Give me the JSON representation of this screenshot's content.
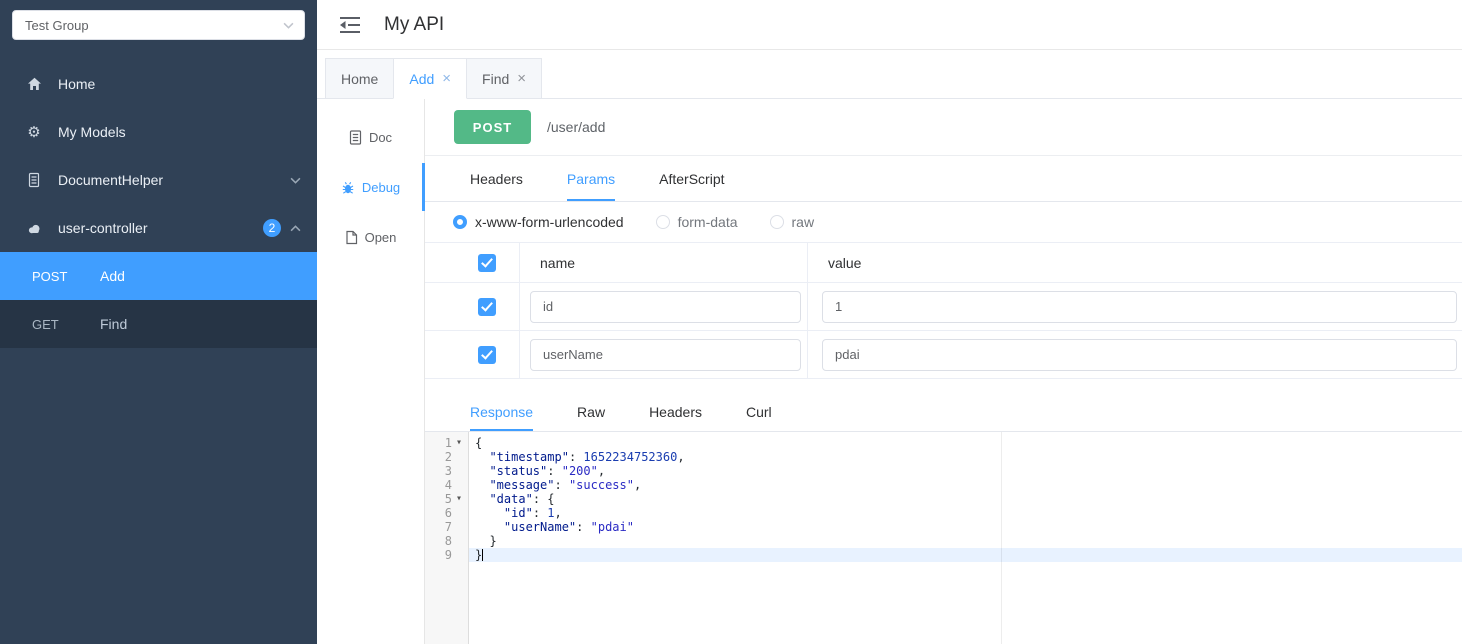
{
  "sidebar": {
    "group_select": {
      "value": "Test Group"
    },
    "menu": [
      {
        "label": "Home",
        "icon": "home-icon"
      },
      {
        "label": "My Models",
        "icon": "models-icon"
      },
      {
        "label": "DocumentHelper",
        "icon": "document-icon",
        "expand": "down"
      },
      {
        "label": "user-controller",
        "icon": "controller-icon",
        "badge": "2",
        "expand": "up"
      }
    ],
    "submenu": [
      {
        "method": "POST",
        "label": "Add",
        "active": true
      },
      {
        "method": "GET",
        "label": "Find",
        "active": false
      }
    ]
  },
  "header": {
    "title": "My API"
  },
  "page_tabs": [
    {
      "label": "Home",
      "closable": false,
      "active": false
    },
    {
      "label": "Add",
      "closable": true,
      "active": true
    },
    {
      "label": "Find",
      "closable": true,
      "active": false
    }
  ],
  "tools": [
    {
      "label": "Doc",
      "active": false
    },
    {
      "label": "Debug",
      "active": true
    },
    {
      "label": "Open",
      "active": false
    }
  ],
  "request": {
    "method": "POST",
    "method_color": "#53b987",
    "path": "/user/add",
    "tabs": [
      "Headers",
      "Params",
      "AfterScript"
    ],
    "active_tab": "Params",
    "body_types": [
      "x-www-form-urlencoded",
      "form-data",
      "raw"
    ],
    "selected_body_type": "x-www-form-urlencoded",
    "params": {
      "columns": [
        "name",
        "value"
      ],
      "rows": [
        {
          "checked": true,
          "name": "id",
          "value": "1"
        },
        {
          "checked": true,
          "name": "userName",
          "value": "pdai"
        }
      ]
    }
  },
  "response": {
    "tabs": [
      "Response",
      "Raw",
      "Headers",
      "Curl"
    ],
    "active_tab": "Response",
    "editor": {
      "active_line": 9,
      "fold_lines": [
        1,
        5
      ],
      "lines": [
        "{",
        "  \"timestamp\": 1652234752360,",
        "  \"status\": \"200\",",
        "  \"message\": \"success\",",
        "  \"data\": {",
        "    \"id\": 1,",
        "    \"userName\": \"pdai\"",
        "  }",
        "}"
      ],
      "colors": {
        "key": "#001a8c",
        "string": "#2a2ac4",
        "number": "#1a3db0",
        "punct": "#24292e"
      }
    }
  },
  "colors": {
    "accent": "#409EFF",
    "sidebar_bg": "#304156",
    "submenu_bg": "#263445"
  }
}
